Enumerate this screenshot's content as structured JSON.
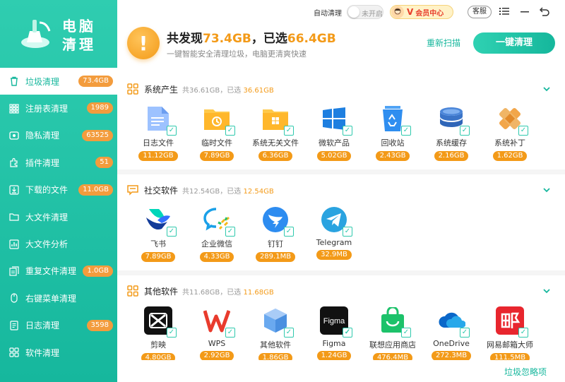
{
  "app": {
    "logo_text_line1": "电脑",
    "logo_text_line2": "清理"
  },
  "sidebar": {
    "items": [
      {
        "label": "垃圾清理",
        "badge": "73.4GB",
        "icon": "trash-icon",
        "active": true
      },
      {
        "label": "注册表清理",
        "badge": "1989",
        "icon": "registry-icon"
      },
      {
        "label": "隐私清理",
        "badge": "63525",
        "icon": "privacy-icon"
      },
      {
        "label": "插件清理",
        "badge": "51",
        "icon": "plugin-icon"
      },
      {
        "label": "下载的文件",
        "badge": "11.0GB",
        "icon": "download-icon"
      },
      {
        "label": "大文件清理",
        "badge": "",
        "icon": "folder-icon"
      },
      {
        "label": "大文件分析",
        "badge": "",
        "icon": "analysis-icon"
      },
      {
        "label": "重复文件清理",
        "badge": "1.0GB",
        "icon": "duplicate-icon"
      },
      {
        "label": "右键菜单清理",
        "badge": "",
        "icon": "mouse-icon"
      },
      {
        "label": "日志清理",
        "badge": "3598",
        "icon": "log-icon"
      },
      {
        "label": "软件清理",
        "badge": "",
        "icon": "apps-icon"
      }
    ]
  },
  "topbar": {
    "auto_clean_label": "自动清理",
    "toggle_text": "未开启",
    "vip_v": "V",
    "vip_label": "会员中心",
    "support_label": "客服"
  },
  "summary": {
    "prefix": "共发现",
    "found": "73.4GB",
    "middle": "，已选",
    "selected": "66.4GB",
    "subtitle": "一键智能安全清理垃圾，电脑更清爽快速",
    "rescan_label": "重新扫描",
    "oneclick_label": "一键清理"
  },
  "sections": [
    {
      "title": "系统产生",
      "stats_prefix": "共36.61GB，已选",
      "stats_selected": "36.61GB",
      "apps": [
        {
          "name": "日志文件",
          "size": "11.12GB",
          "icon": "log-file-icon"
        },
        {
          "name": "临时文件",
          "size": "7.89GB",
          "icon": "temp-file-icon"
        },
        {
          "name": "系统无关文件",
          "size": "6.36GB",
          "icon": "system-file-icon"
        },
        {
          "name": "微软产品",
          "size": "5.02GB",
          "icon": "windows-icon"
        },
        {
          "name": "回收站",
          "size": "2.43GB",
          "icon": "recycle-bin-icon"
        },
        {
          "name": "系统缓存",
          "size": "2.16GB",
          "icon": "cache-icon"
        },
        {
          "name": "系统补丁",
          "size": "1.62GB",
          "icon": "patch-icon"
        }
      ]
    },
    {
      "title": "社交软件",
      "stats_prefix": "共12.54GB，已选",
      "stats_selected": "12.54GB",
      "apps": [
        {
          "name": "飞书",
          "size": "7.89GB",
          "icon": "feishu-icon"
        },
        {
          "name": "企业微信",
          "size": "4.33GB",
          "icon": "wecom-icon"
        },
        {
          "name": "钉钉",
          "size": "289.1MB",
          "icon": "dingtalk-icon"
        },
        {
          "name": "Telegram",
          "size": "32.9MB",
          "icon": "telegram-icon"
        }
      ]
    },
    {
      "title": "其他软件",
      "stats_prefix": "共11.68GB，已选",
      "stats_selected": "11.68GB",
      "apps": [
        {
          "name": "剪映",
          "size": "4.80GB",
          "icon": "capcut-icon"
        },
        {
          "name": "WPS",
          "size": "2.92GB",
          "icon": "wps-icon"
        },
        {
          "name": "其他软件",
          "size": "1.86GB",
          "icon": "cube-icon"
        },
        {
          "name": "Figma",
          "size": "1.24GB",
          "icon": "figma-icon"
        },
        {
          "name": "联想应用商店",
          "size": "476.4MB",
          "icon": "lenovo-store-icon"
        },
        {
          "name": "OneDrive",
          "size": "272.3MB",
          "icon": "onedrive-icon"
        },
        {
          "name": "网易邮箱大师",
          "size": "111.5MB",
          "icon": "netease-mail-icon"
        }
      ]
    }
  ],
  "footer": {
    "ignore_label": "垃圾忽略项"
  },
  "colors": {
    "accent": "#16b79d",
    "warning": "#f39a18"
  }
}
